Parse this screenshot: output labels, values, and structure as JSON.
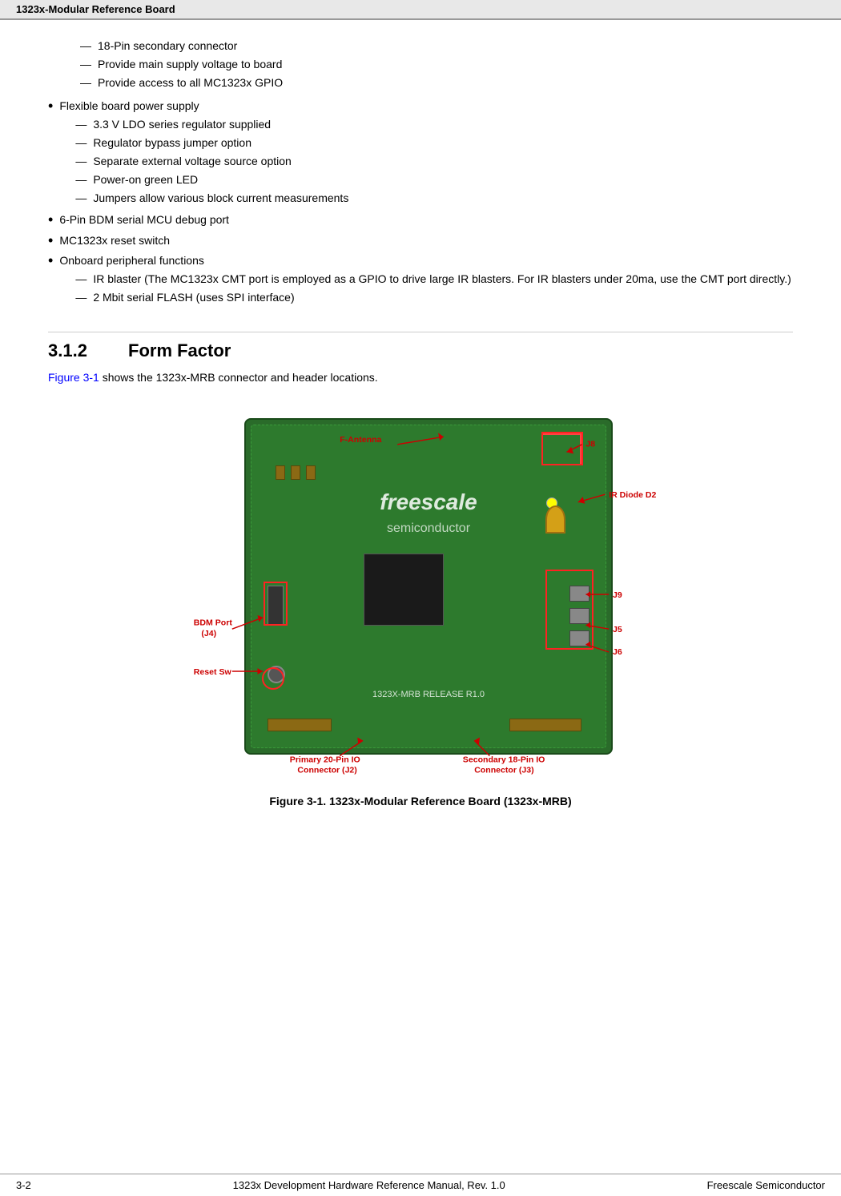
{
  "header": {
    "title": "1323x-Modular Reference Board"
  },
  "footer": {
    "left": "3-2",
    "center": "1323x Development Hardware Reference Manual, Rev. 1.0",
    "right": "Freescale Semiconductor"
  },
  "content": {
    "bullet_items": [
      {
        "id": "b1",
        "sub_items": [
          "18-Pin secondary connector",
          "Provide main supply voltage to board",
          "Provide access to all MC1323x GPIO"
        ]
      },
      {
        "id": "b2",
        "label": "Flexible board power supply",
        "sub_items": [
          "3.3 V LDO series regulator supplied",
          "Regulator bypass jumper option",
          "Separate external voltage source option",
          "Power-on green LED",
          "Jumpers allow various block current measurements"
        ]
      },
      {
        "id": "b3",
        "label": "6-Pin BDM serial MCU debug port"
      },
      {
        "id": "b4",
        "label": "MC1323x reset switch"
      },
      {
        "id": "b5",
        "label": "Onboard peripheral functions",
        "sub_items_long": [
          {
            "text": "IR blaster (The MC1323x CMT port is employed as a GPIO to drive large IR blasters. For IR blasters under 20ma, use the CMT port directly.)"
          },
          {
            "text": "2 Mbit serial FLASH (uses SPI interface)"
          }
        ]
      }
    ],
    "section": {
      "number": "3.1.2",
      "title": "Form Factor"
    },
    "figure_intro": "Figure 3-1 shows the 1323x-MRB connector and header locations.",
    "figure_intro_link": "Figure 3-1",
    "annotations": {
      "f_antenna": "F-Antenna",
      "j8": "J8",
      "ir_diode_d2": "IR Diode D2",
      "j9": "J9",
      "bdm_port": "BDM Port\n(J4)",
      "reset_sw": "Reset Sw",
      "j5": "J5",
      "j6": "J6",
      "primary_connector": "Primary 20-Pin IO\nConnector (J2)",
      "secondary_connector": "Secondary 18-Pin IO\nConnector (J3)"
    },
    "figure_caption": "Figure 3-1. 1323x-Modular Reference Board (1323x-MRB)"
  }
}
